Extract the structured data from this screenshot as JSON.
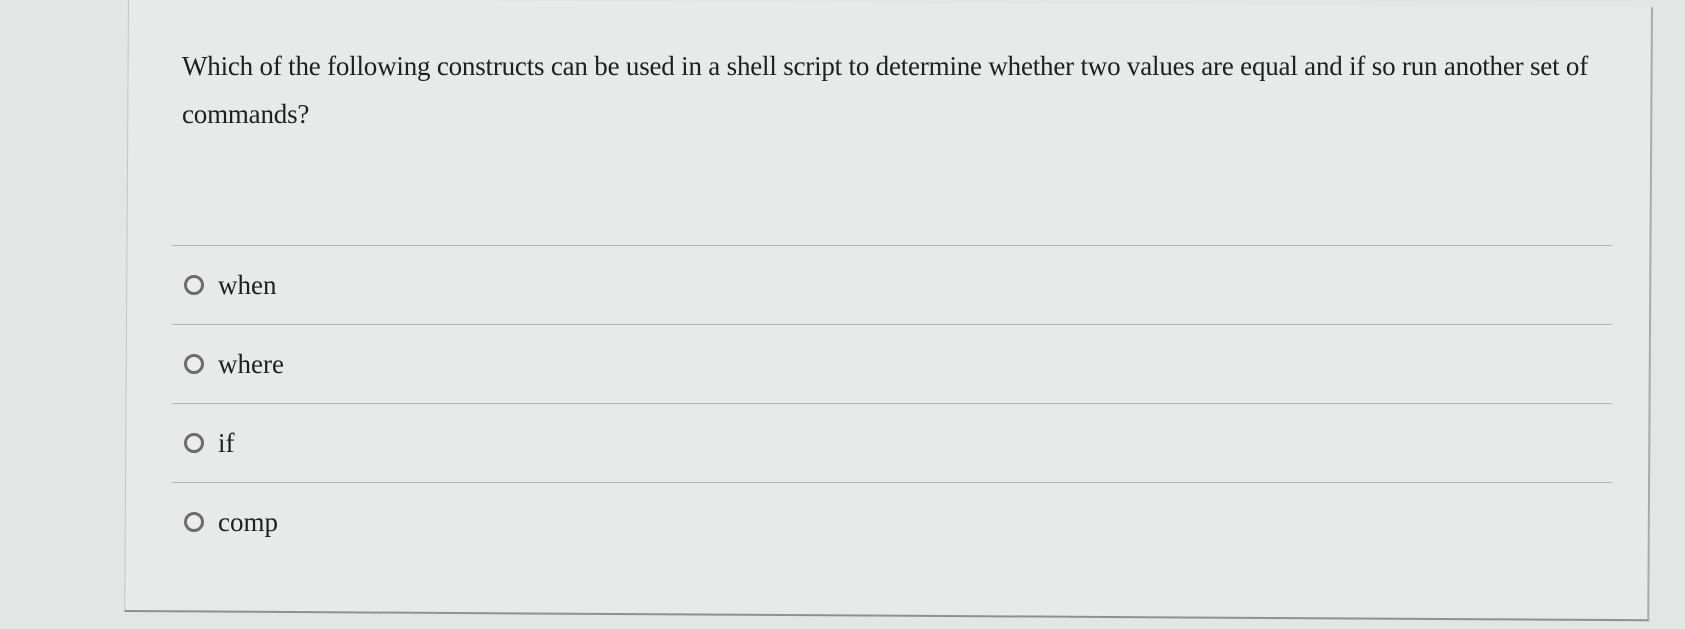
{
  "question": {
    "text": "Which of the following constructs can be used in a shell script to determine whether two values are equal and if so run another set of commands?"
  },
  "options": [
    {
      "label": "when",
      "selected": false
    },
    {
      "label": "where",
      "selected": false
    },
    {
      "label": "if",
      "selected": false
    },
    {
      "label": "comp",
      "selected": false
    }
  ]
}
